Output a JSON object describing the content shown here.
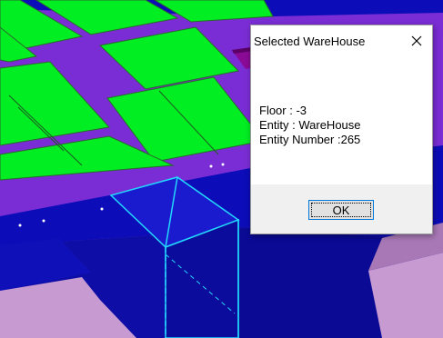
{
  "dialog": {
    "title": "Selected WareHouse",
    "close_icon": "close-icon",
    "lines": {
      "floor": "Floor : -3",
      "entity": "Entity : WareHouse",
      "entity_number": "Entity Number :265"
    },
    "ok_label": "OK"
  },
  "colors": {
    "green_tiles": "#00ee22",
    "purple_floor": "#7a2dd4",
    "dark_blue": "#0c0cb8",
    "selection_blue": "#1a1acf",
    "selection_edge": "#22d8ff",
    "pink_wall": "#c79ad2",
    "magenta_box": "#8a0a96",
    "dialog_footer": "#f0f0f0",
    "ok_border": "#0078d7"
  }
}
